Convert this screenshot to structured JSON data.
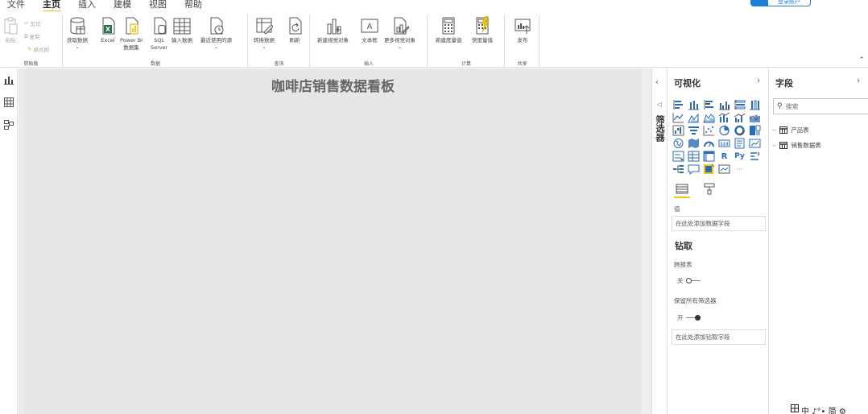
{
  "menu": {
    "items": [
      {
        "label": "文件",
        "active": false
      },
      {
        "label": "主页",
        "active": true
      },
      {
        "label": "插入",
        "active": false
      },
      {
        "label": "建模",
        "active": false
      },
      {
        "label": "视图",
        "active": false
      },
      {
        "label": "帮助",
        "active": false
      }
    ],
    "signin_label": "登录账户"
  },
  "ribbon": {
    "clipboard": {
      "paste": "粘贴",
      "cut": "剪切",
      "copy": "复制",
      "format_painter": "格式刷",
      "group": "剪贴板"
    },
    "data": {
      "get_data": "获取数据",
      "excel": "Excel",
      "pbi_line1": "Power BI",
      "pbi_line2": "数据集",
      "sql_line1": "SQL",
      "sql_line2": "Server",
      "enter_data": "输入数据",
      "recent": "最近使用的源",
      "group": "数据"
    },
    "queries": {
      "transform": "转换数据",
      "refresh": "刷新",
      "group": "查询"
    },
    "insert": {
      "new_visual": "新建视觉对象",
      "text_box": "文本框",
      "more_visuals": "更多视觉对象",
      "group": "插入"
    },
    "calc": {
      "new_measure": "新建度量值",
      "quick_measure": "快度量值",
      "group": "计算"
    },
    "share": {
      "publish": "发布",
      "group": "共享"
    }
  },
  "canvas": {
    "title": "咖啡店销售数据看板"
  },
  "filters": {
    "label": "筛选器"
  },
  "visualizations": {
    "title": "可视化",
    "values_label": "值",
    "values_placeholder": "在此处添加数据字段",
    "drillthrough_title": "钻取",
    "cross_report_label": "跨报表",
    "cross_report_state": "关",
    "keep_filters_label": "保留所有筛选器",
    "keep_filters_state": "开",
    "drill_placeholder": "在此处添加钻取字段"
  },
  "fields": {
    "title": "字段",
    "search_placeholder": "搜索",
    "tables": [
      "产品表",
      "销售数据表"
    ]
  },
  "ime": {
    "text": "中 ♪°• 简 ⚙"
  },
  "colors": {
    "accent": "#f2c811",
    "excel_green": "#217346",
    "pbi_yellow": "#f2c811",
    "viz_blue": "#2b6bb8",
    "brand_blue": "#1e7fd6"
  }
}
